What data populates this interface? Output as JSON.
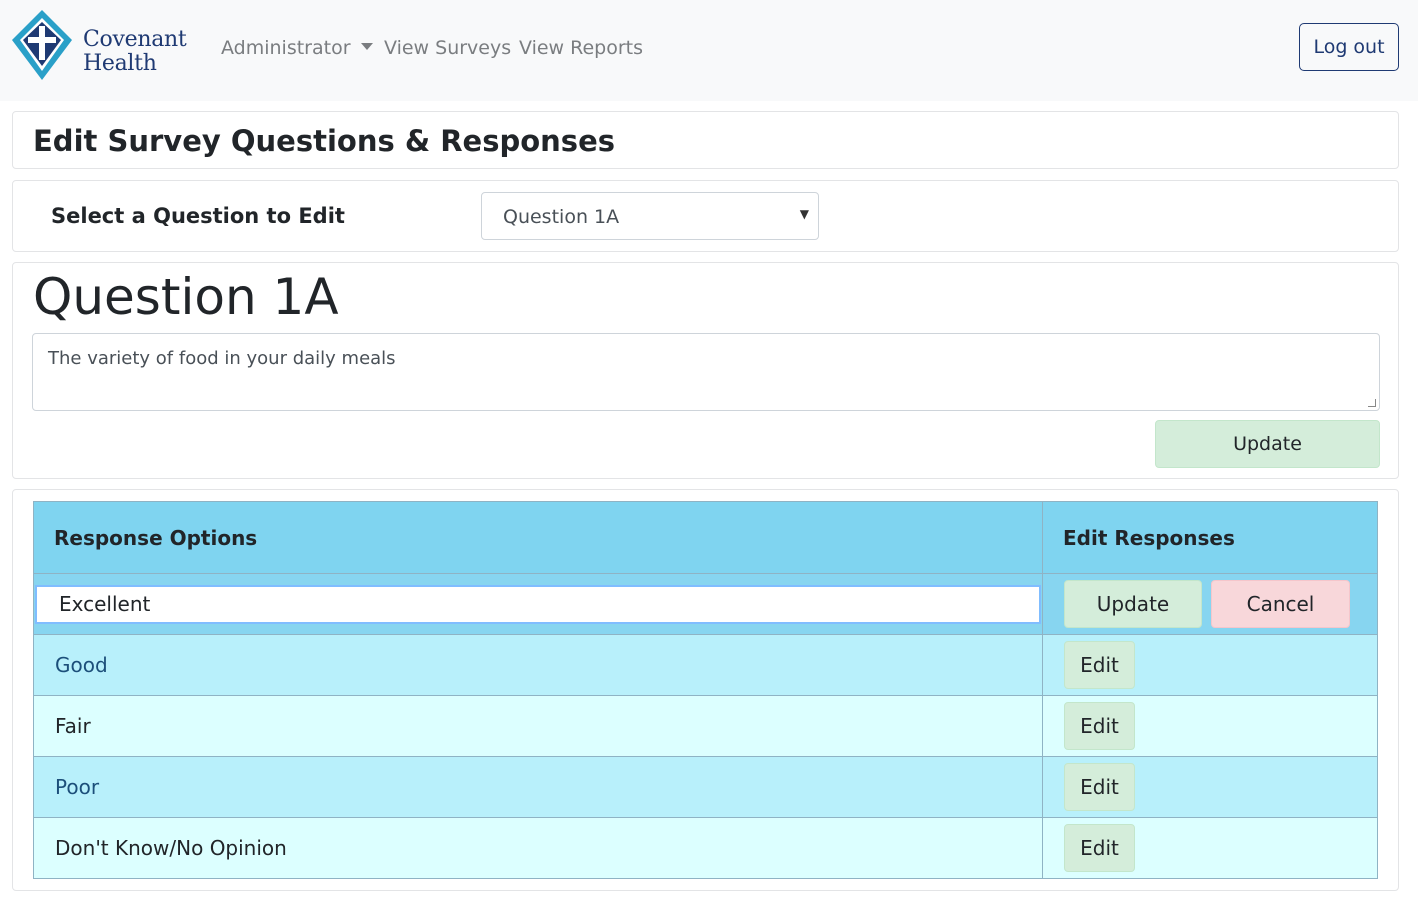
{
  "navbar": {
    "brand_line1": "Covenant",
    "brand_line2": "Health",
    "admin_label": "Administrator",
    "surveys_label": "View Surveys",
    "reports_label": "View Reports",
    "logout_label": "Log out"
  },
  "page": {
    "title": "Edit Survey Questions & Responses",
    "select_label": "Select a Question to Edit",
    "selected_question": "Question 1A"
  },
  "question": {
    "heading": "Question 1A",
    "text": "The variety of food in your daily meals",
    "update_label": "Update"
  },
  "responses": {
    "col_options": "Response Options",
    "col_edit": "Edit Responses",
    "editing": {
      "value": "Excellent",
      "update_label": "Update",
      "cancel_label": "Cancel"
    },
    "rows": [
      {
        "label": "Good",
        "edit_label": "Edit"
      },
      {
        "label": "Fair",
        "edit_label": "Edit"
      },
      {
        "label": "Poor",
        "edit_label": "Edit"
      },
      {
        "label": "Don't Know/No Opinion",
        "edit_label": "Edit"
      }
    ]
  },
  "colors": {
    "brand": "#1f3a73",
    "logo_accent": "#2aa0c8",
    "table_header": "#7fd4f0",
    "row_alt": "#b8f0fb",
    "row_light": "#dcffff",
    "success_bg": "#d4edda",
    "danger_bg": "#f8d7da"
  }
}
